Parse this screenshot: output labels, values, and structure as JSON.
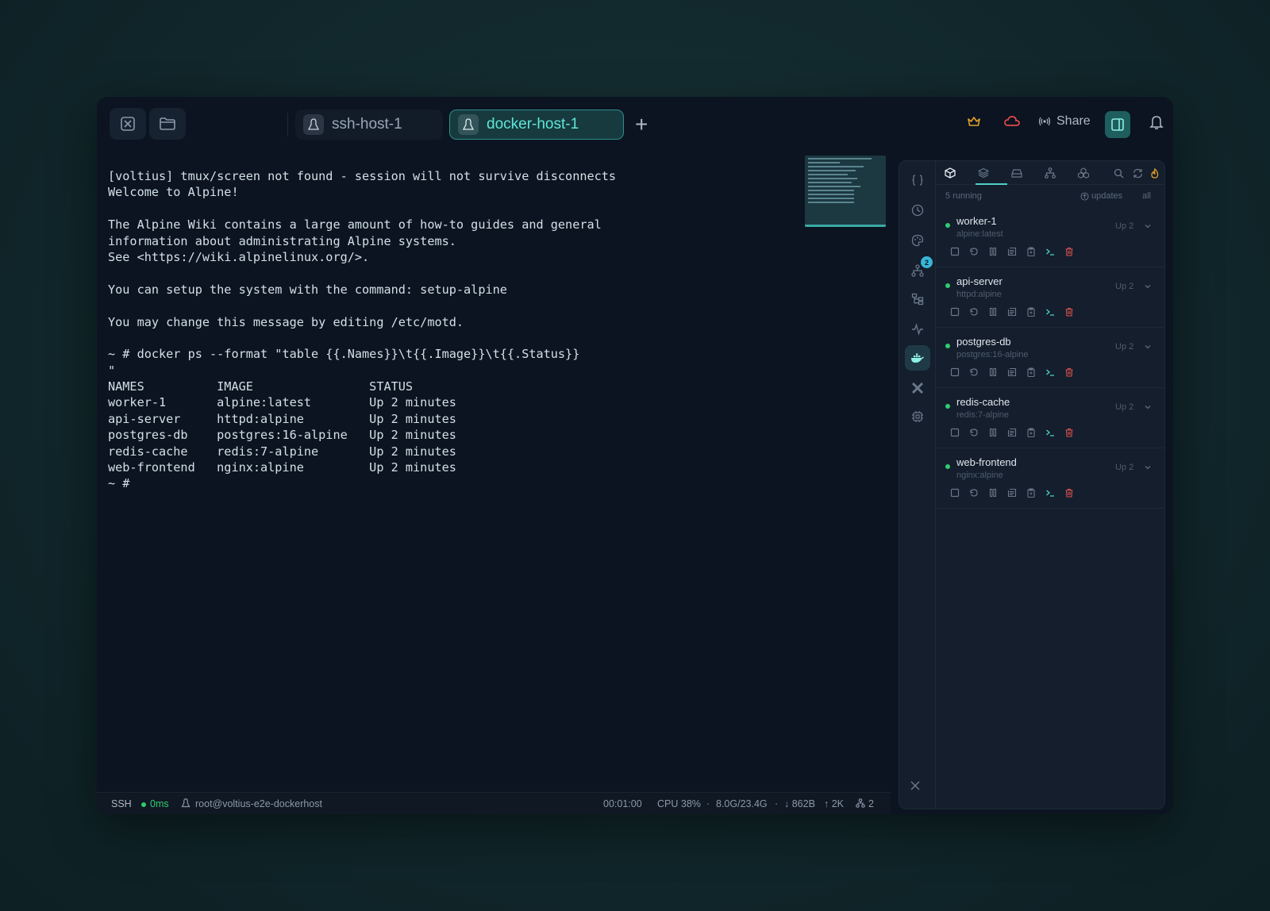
{
  "titlebar": {
    "tabs": [
      {
        "label": "ssh-host-1",
        "active": false
      },
      {
        "label": "docker-host-1",
        "active": true
      }
    ],
    "add_tab": "+",
    "share_label": "Share",
    "icons": [
      "close-session-icon",
      "folder-icon",
      "crown-icon",
      "cloud-icon",
      "broadcast-icon",
      "layout-panel-icon",
      "bell-icon",
      "minimize-icon",
      "maximize-icon",
      "close-icon"
    ]
  },
  "terminal": {
    "lines": [
      "[voltius] tmux/screen not found - session will not survive disconnects",
      "Welcome to Alpine!",
      "",
      "The Alpine Wiki contains a large amount of how-to guides and general",
      "information about administrating Alpine systems.",
      "See <https://wiki.alpinelinux.org/>.",
      "",
      "You can setup the system with the command: setup-alpine",
      "",
      "You may change this message by editing /etc/motd.",
      "",
      "~ # docker ps --format \"table {{.Names}}\\t{{.Image}}\\t{{.Status}}",
      "\"",
      "NAMES          IMAGE                STATUS",
      "worker-1       alpine:latest        Up 2 minutes",
      "api-server     httpd:alpine         Up 2 minutes",
      "postgres-db    postgres:16-alpine   Up 2 minutes",
      "redis-cache    redis:7-alpine       Up 2 minutes",
      "web-frontend   nginx:alpine         Up 2 minutes",
      "~ #"
    ]
  },
  "statusbar": {
    "protocol": "SSH",
    "latency": "0ms",
    "user_host": "root@voltius-e2e-dockerhost",
    "uptime": "00:01:00",
    "cpu": "CPU 38%",
    "memory": "8.0G/23.4G",
    "net_down": "↓ 862B",
    "net_up": "↑ 2K",
    "connections": "2"
  },
  "panel": {
    "running_count": "5 running",
    "updates_label": "updates",
    "all_label": "all",
    "rail_badge": "2",
    "containers": [
      {
        "name": "worker-1",
        "image": "alpine:latest",
        "status": "Up 2"
      },
      {
        "name": "api-server",
        "image": "httpd:alpine",
        "status": "Up 2"
      },
      {
        "name": "postgres-db",
        "image": "postgres:16-alpine",
        "status": "Up 2"
      },
      {
        "name": "redis-cache",
        "image": "redis:7-alpine",
        "status": "Up 2"
      },
      {
        "name": "web-frontend",
        "image": "nginx:alpine",
        "status": "Up 2"
      }
    ]
  },
  "colors": {
    "accent": "#4fd1c5",
    "status_running": "#2ecc71",
    "danger": "#d9534f",
    "crown": "#e0a028",
    "cloud": "#e04a4a"
  }
}
